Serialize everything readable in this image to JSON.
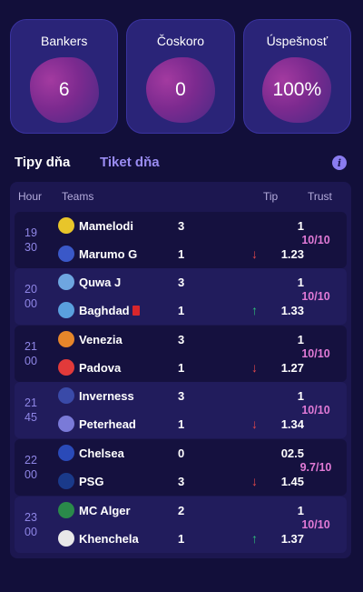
{
  "stats": [
    {
      "label": "Bankers",
      "value": "6"
    },
    {
      "label": "Čoskoro",
      "value": "0"
    },
    {
      "label": "Úspešnosť",
      "value": "100%"
    }
  ],
  "tabs": {
    "active": "Tipy dňa",
    "inactive": "Tiket dňa"
  },
  "info_icon_glyph": "i",
  "table": {
    "headers": {
      "hour": "Hour",
      "teams": "Teams",
      "tip": "Tip",
      "trust": "Trust"
    },
    "matches": [
      {
        "hour_h": "19",
        "hour_m": "30",
        "home": "Mamelodi",
        "home_score": "3",
        "away": "Marumo G",
        "away_score": "1",
        "tip": "1",
        "odds": "1.23",
        "trend": "down",
        "trend_glyph": "↓",
        "trust": "10/10",
        "home_crest": "#e8c52a",
        "away_crest": "#3a58c8"
      },
      {
        "hour_h": "20",
        "hour_m": "00",
        "home": "Quwa J",
        "home_score": "3",
        "away": "Baghdad",
        "away_score": "1",
        "tip": "1",
        "odds": "1.33",
        "trend": "up",
        "trend_glyph": "↑",
        "trust": "10/10",
        "home_crest": "#6ea6e0",
        "away_crest": "#5aa0de",
        "away_red_card": true
      },
      {
        "hour_h": "21",
        "hour_m": "00",
        "home": "Venezia",
        "home_score": "3",
        "away": "Padova",
        "away_score": "1",
        "tip": "1",
        "odds": "1.27",
        "trend": "down",
        "trend_glyph": "↓",
        "trust": "10/10",
        "home_crest": "#e6862a",
        "away_crest": "#e23a3a"
      },
      {
        "hour_h": "21",
        "hour_m": "45",
        "home": "Inverness",
        "home_score": "3",
        "away": "Peterhead",
        "away_score": "1",
        "tip": "1",
        "odds": "1.34",
        "trend": "down",
        "trend_glyph": "↓",
        "trust": "10/10",
        "home_crest": "#3a4aa8",
        "away_crest": "#7a7ad8"
      },
      {
        "hour_h": "22",
        "hour_m": "00",
        "home": "Chelsea",
        "home_score": "0",
        "away": "PSG",
        "away_score": "3",
        "tip": "02.5",
        "odds": "1.45",
        "trend": "down",
        "trend_glyph": "↓",
        "trust": "9.7/10",
        "home_crest": "#2a4ab8",
        "away_crest": "#1a3a8a"
      },
      {
        "hour_h": "23",
        "hour_m": "00",
        "home": "MC Alger",
        "home_score": "2",
        "away": "Khenchela",
        "away_score": "1",
        "tip": "1",
        "odds": "1.37",
        "trend": "up",
        "trend_glyph": "↑",
        "trust": "10/10",
        "home_crest": "#2a8a4a",
        "away_crest": "#e8e8e8"
      }
    ]
  }
}
